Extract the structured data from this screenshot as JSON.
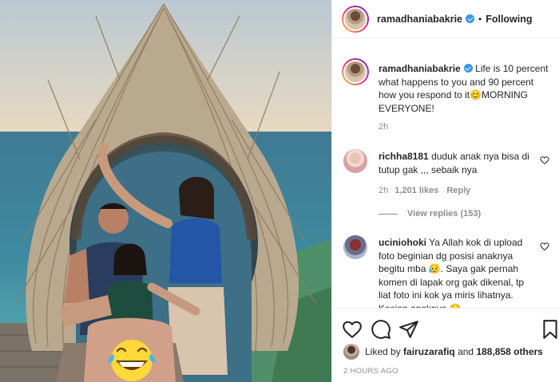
{
  "post": {
    "username": "ramadhaniabakrie",
    "follow_state": "Following",
    "separator": "•",
    "caption": {
      "username": "ramadhaniabakrie",
      "text": "Life is 10 percent what happens to you and 90 percent how you respond to it😊MORNING EVERYONE!",
      "time": "2h"
    },
    "comments": [
      {
        "username": "richha8181",
        "text": "duduk anak nya bisa di tutup gak ,,, sebaik nya",
        "time": "2h",
        "likes": "1,201 likes",
        "reply_label": "Reply",
        "view_replies": "View replies (153)"
      },
      {
        "username": "uciniohoki",
        "text": "Ya Allah kok di upload foto beginian dg posisi anaknya begitu mba 😥. Saya gak pernah komen di lapak org gak dikenal, tp liat foto ini kok ya miris lihatnya. Kasian anaknya 😥"
      }
    ],
    "liked_by": {
      "prefix": "Liked by",
      "user": "fairuzarafiq",
      "middle": "and",
      "count": "188,858 others"
    },
    "time_ago": "2 HOURS AGO",
    "photo_overlay_emoji": "laughing-with-tears-emoji"
  },
  "icons": [
    "verified-badge-icon",
    "heart-icon",
    "comment-icon",
    "share-icon",
    "bookmark-icon"
  ],
  "colors": {
    "verified": "#3897f0",
    "secondary_text": "#8e8e8e",
    "border": "#efefef"
  }
}
